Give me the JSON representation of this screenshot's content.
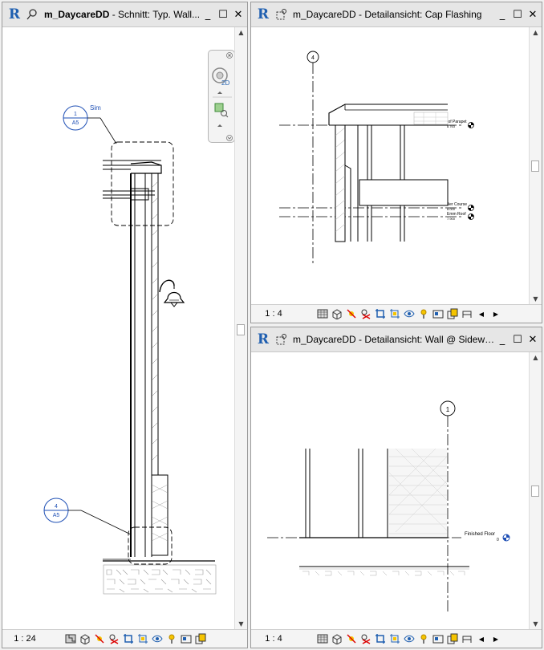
{
  "windows": {
    "left": {
      "title_bold": "m_DaycareDD",
      "title_rest": " - Schnitt: Typ. Wall...",
      "scale": "1 : 24",
      "tags": {
        "section_num": "1",
        "section_sheet": "A5",
        "section_note": "Sim",
        "detail_num": "4",
        "detail_sheet": "A5"
      },
      "navbar": {
        "zoom_label": "2D"
      }
    },
    "top_right": {
      "title_bold": "m_DaycareDD",
      "title_rest": " - Detailansicht: Cap Flashing",
      "scale": "1 : 4",
      "grid_label": "4",
      "levels": [
        {
          "name": "Top of Parapet",
          "elev": "8.763"
        },
        {
          "name": "Soldier Course",
          "elev": "8.000"
        },
        {
          "name": "Emm Roof",
          "elev": "7.900"
        }
      ]
    },
    "bottom_right": {
      "title_bold": "m_DaycareDD",
      "title_rest": " - Detailansicht: Wall @ Sidewalk",
      "scale": "1 : 4",
      "grid_label": "1",
      "level": {
        "name": "Finished Floor",
        "elev": "0"
      }
    }
  },
  "window_buttons": {
    "minimize": "_",
    "maximize": "☐",
    "close": "✕"
  },
  "colors": {
    "revit_blue": "#1f5fb0",
    "tag_blue": "#1e4fb5"
  }
}
